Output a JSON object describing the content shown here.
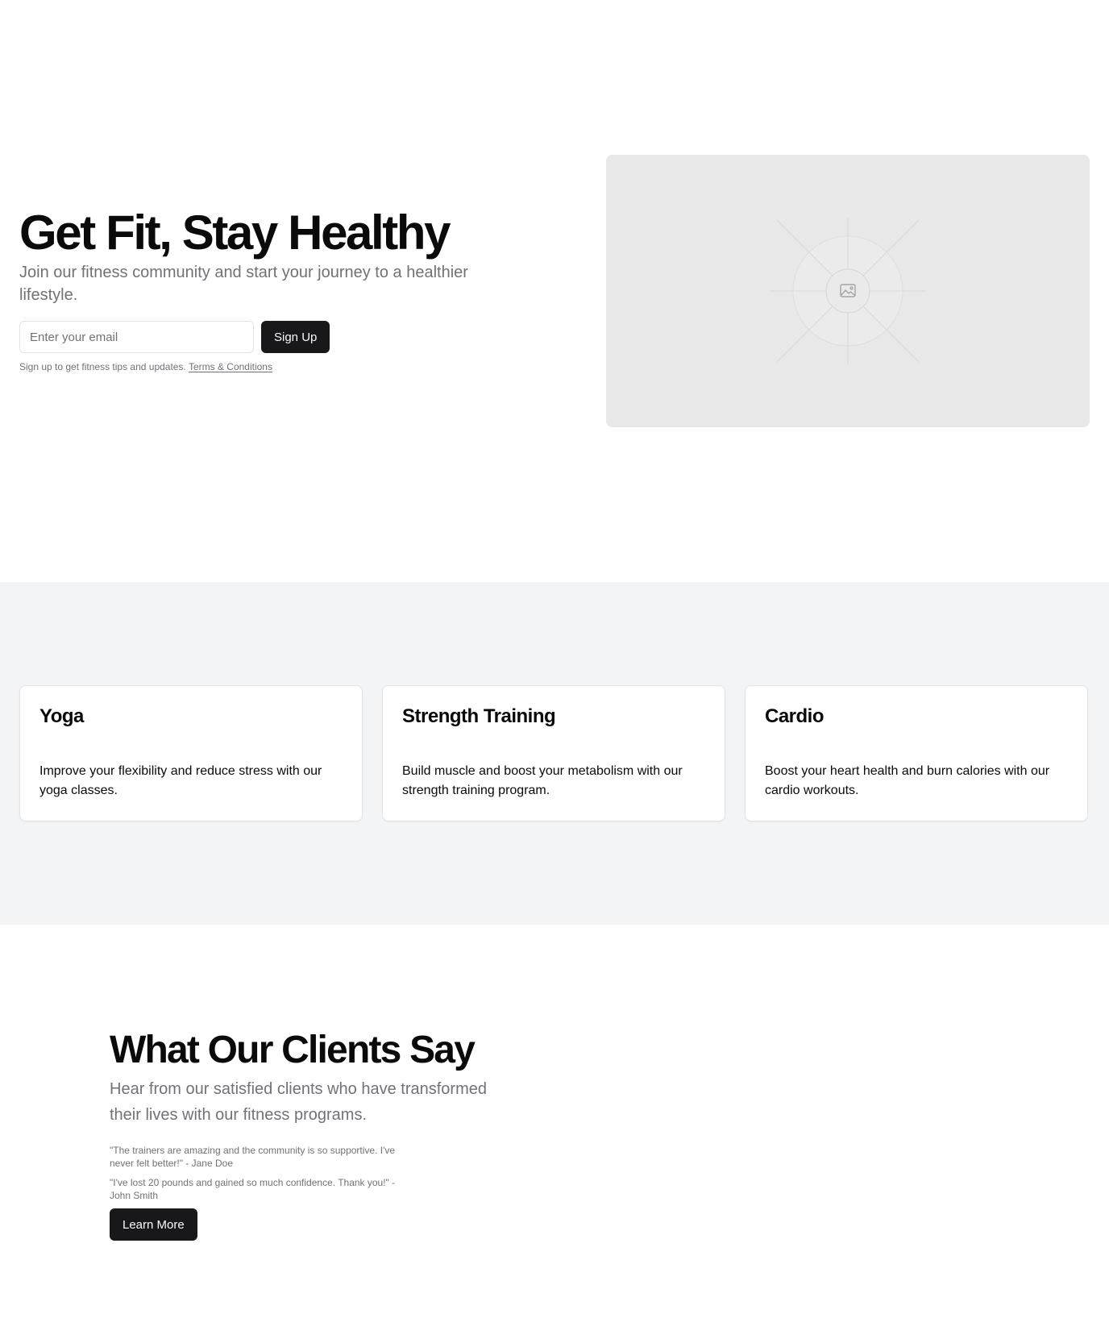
{
  "hero": {
    "title": "Get Fit, Stay Healthy",
    "subtitle": "Join our fitness community and start your journey to a healthier lifestyle.",
    "email_placeholder": "Enter your email",
    "signup_label": "Sign Up",
    "fine_print": "Sign up to get fitness tips and updates.",
    "terms_link": "Terms & Conditions",
    "image_icon": "image-placeholder-icon"
  },
  "features": {
    "cards": [
      {
        "title": "Yoga",
        "description": "Improve your flexibility and reduce stress with our yoga classes."
      },
      {
        "title": "Strength Training",
        "description": "Build muscle and boost your metabolism with our strength training program."
      },
      {
        "title": "Cardio",
        "description": "Boost your heart health and burn calories with our cardio workouts."
      }
    ]
  },
  "testimonials": {
    "title": "What Our Clients Say",
    "subtitle": "Hear from our satisfied clients who have transformed their lives with our fitness programs.",
    "quotes": [
      "\"The trainers are amazing and the community is so supportive. I've never felt better!\" - Jane Doe",
      "\"I've lost 20 pounds and gained so much confidence. Thank you!\" - John Smith"
    ],
    "cta_label": "Learn More"
  },
  "colors": {
    "primary": "#18181b",
    "muted_text": "#71717a",
    "section_bg": "#f3f4f6",
    "image_placeholder_bg": "#e8e8e8"
  }
}
